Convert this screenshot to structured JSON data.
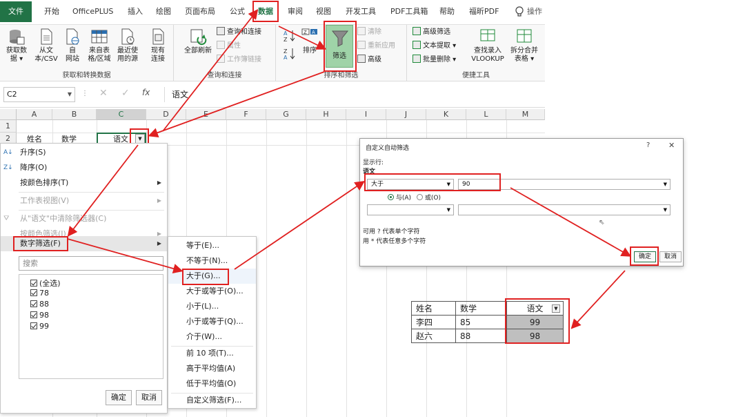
{
  "tabs": {
    "file": "文件",
    "items": [
      "开始",
      "OfficePLUS",
      "插入",
      "绘图",
      "页面布局",
      "公式",
      "数据",
      "审阅",
      "视图",
      "开发工具",
      "PDF工具箱",
      "帮助",
      "福昕PDF",
      "操作"
    ],
    "active": "数据"
  },
  "ribbon": {
    "group1": {
      "label": "获取和转换数据",
      "b1": [
        "获取数",
        "据 ▾"
      ],
      "b2": [
        "从文",
        "本/CSV"
      ],
      "b3": [
        "自",
        "网站"
      ],
      "b4": [
        "来自表",
        "格/区域"
      ],
      "b5": [
        "最近使",
        "用的源"
      ],
      "b6": [
        "现有",
        "连接"
      ]
    },
    "group2": {
      "label": "查询和连接",
      "refresh": [
        "全部刷新",
        ""
      ],
      "q1": "查询和连接",
      "q2": "属性",
      "q3": "工作簿链接"
    },
    "group3": {
      "label": "排序和筛选",
      "sort": "排序",
      "filter": "筛选",
      "clear": "清除",
      "reapply": "重新应用",
      "advanced": "高级"
    },
    "group4": {
      "label": "便捷工具",
      "adv_filter": "高级筛选",
      "text_extract": "文本提取 ▾",
      "batch_delete": "批量删除 ▾",
      "vlookup": [
        "查找录入",
        "VLOOKUP"
      ],
      "split": [
        "拆分合并",
        "表格 ▾"
      ]
    }
  },
  "formula_bar": {
    "name_box": "C2",
    "value": "语文"
  },
  "columns": [
    "A",
    "B",
    "C",
    "D",
    "E",
    "F",
    "G",
    "H",
    "I",
    "J",
    "K",
    "L",
    "M"
  ],
  "rows": [
    "1",
    "2"
  ],
  "header_cells": {
    "a2": "姓名",
    "b2": "数学",
    "c2": "语文"
  },
  "filter_menu": {
    "sort_asc": "升序(S)",
    "sort_desc": "降序(O)",
    "sort_color": "按颜色排序(T)",
    "sheet_view": "工作表视图(V)",
    "clear_filter": "从\"语文\"中清除筛选器(C)",
    "color_filter": "按颜色筛选(I)",
    "number_filter": "数字筛选(F)",
    "search_placeholder": "搜索",
    "checklist": [
      "(全选)",
      "78",
      "88",
      "98",
      "99"
    ],
    "ok": "确定",
    "cancel": "取消"
  },
  "number_submenu": [
    "等于(E)...",
    "不等于(N)...",
    "大于(G)...",
    "大于或等于(O)...",
    "小于(L)...",
    "小于或等于(Q)...",
    "介于(W)...",
    "前 10 项(T)...",
    "高于平均值(A)",
    "低于平均值(O)",
    "自定义筛选(F)..."
  ],
  "dialog": {
    "title": "自定义自动筛选",
    "help": "?",
    "close": "✕",
    "show_rows": "显示行:",
    "field": "语文",
    "operator": "大于",
    "value": "90",
    "and_label": "与(A)",
    "or_label": "或(O)",
    "hint1": "可用 ? 代表单个字符",
    "hint2": "用 * 代表任意多个字符",
    "ok": "确定",
    "cancel": "取消"
  },
  "result_table": {
    "headers": [
      "姓名",
      "数学",
      "语文"
    ],
    "rows": [
      [
        "李四",
        "85",
        "99"
      ],
      [
        "赵六",
        "88",
        "98"
      ]
    ]
  },
  "colors": {
    "excel_green": "#217346",
    "annotation_red": "#e02020",
    "filter_active": "#9fd3a8"
  }
}
